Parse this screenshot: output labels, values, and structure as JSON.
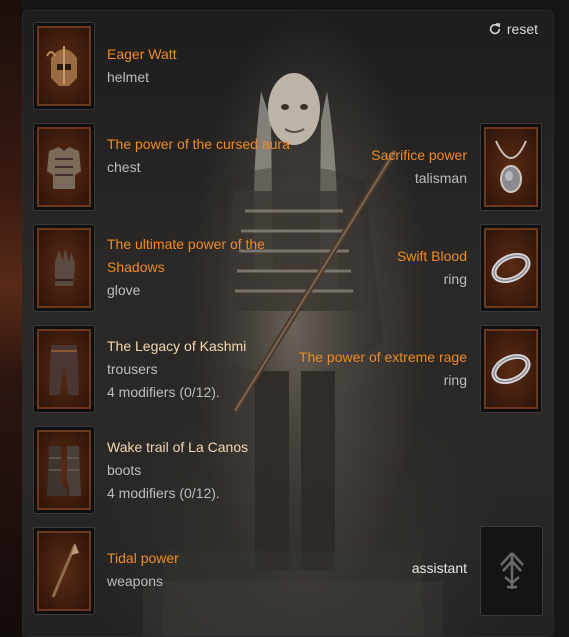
{
  "panel": {
    "reset_label": "reset",
    "assistant_label": "assistant"
  },
  "left_slots": [
    {
      "name": "Eager Watt",
      "type": "helmet",
      "modifiers": "",
      "icon": "helmet-icon"
    },
    {
      "name": "The power of the cursed aura",
      "type": "chest",
      "modifiers": "",
      "icon": "chest-armor-icon"
    },
    {
      "name": "The ultimate power of the Shadows",
      "type": "glove",
      "modifiers": "",
      "icon": "glove-icon"
    },
    {
      "name": "The Legacy of Kashmi",
      "type": "trousers",
      "modifiers": "4 modifiers (0/12).",
      "icon": "trousers-icon"
    },
    {
      "name": "Wake trail of La Canos",
      "type": "boots",
      "modifiers": "4 modifiers (0/12).",
      "icon": "boots-icon"
    },
    {
      "name": "Tidal power",
      "type": "weapons",
      "modifiers": "",
      "icon": "spear-icon"
    }
  ],
  "right_slots": [
    {
      "name": "Sacrifice power",
      "type": "talisman",
      "icon": "amulet-icon"
    },
    {
      "name": "Swift Blood",
      "type": "ring",
      "icon": "ring-icon"
    },
    {
      "name": "The power of extreme rage",
      "type": "ring",
      "icon": "ring-icon"
    }
  ],
  "colors": {
    "legendary_name": "#f08a24",
    "set_name": "#f2d7b0",
    "item_type": "#bdbdbd",
    "slot_frame": "#6b3a1e"
  }
}
